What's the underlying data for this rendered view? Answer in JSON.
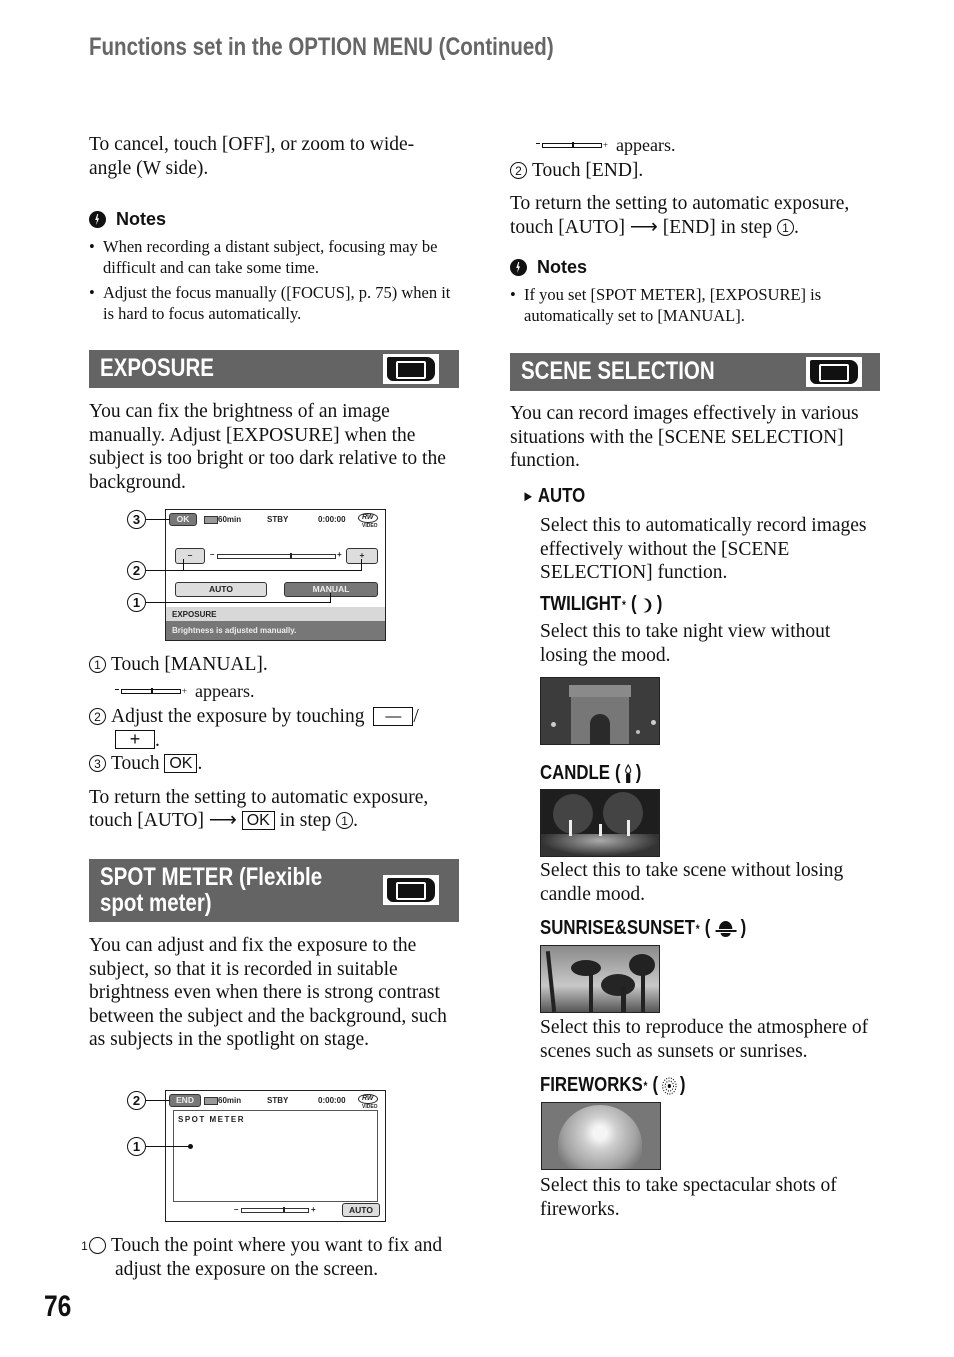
{
  "header": {
    "title": "Functions set in the OPTION MENU (Continued)"
  },
  "page_number": "76",
  "left_column": {
    "intro": "To cancel, touch [OFF], or zoom to wide-angle (W side).",
    "notes": {
      "title": "Notes",
      "icon": "notes-warning-icon",
      "items": [
        "When recording a distant subject, focusing may be difficult and can take some time.",
        "Adjust the focus manually ([FOCUS], p. 75) when it is hard to focus automatically."
      ]
    },
    "exposure": {
      "title": "EXPOSURE",
      "icon": "camcorder-icon",
      "description": "You can fix the brightness of an image manually. Adjust [EXPOSURE] when the subject is too bright or too dark relative to the background.",
      "screen": {
        "ok_button": "OK",
        "battery": "60min",
        "status": "STBY",
        "timecode": "0:00:00",
        "disc": "RW",
        "disc_sub": "VIDEO",
        "minus_button": "–",
        "plus_button": "+",
        "slider_minus": "–",
        "slider_plus": "+",
        "auto_button": "AUTO",
        "manual_button": "MANUAL",
        "panel_title": "EXPOSURE",
        "panel_message": "Brightness is adjusted manually.",
        "callouts": [
          "3",
          "2",
          "1"
        ]
      },
      "steps": {
        "s1_num": "1",
        "s1": "Touch [MANUAL].",
        "s1_appears": "appears.",
        "s2_num": "2",
        "s2": "Adjust the exposure by touching",
        "s2_minus": "—",
        "s2_slash": "/",
        "s2_plus": "+",
        "s2_end": ".",
        "s3_num": "3",
        "s3": "Touch",
        "s3_ok": "OK",
        "s3_end": "."
      },
      "return_text_a": "To return the setting to automatic exposure, touch [AUTO]",
      "return_arrow": "⟶",
      "return_ok": "OK",
      "return_text_b": "in step",
      "return_step": "1",
      "return_end": "."
    },
    "spot_meter": {
      "title_line1": "SPOT METER (Flexible",
      "title_line2": "spot meter)",
      "icon": "camcorder-icon",
      "description": "You can adjust and fix the exposure to the subject, so that it is recorded in suitable brightness even when there is strong contrast between the subject and the background, such as subjects in the spotlight on stage.",
      "screen": {
        "end_button": "END",
        "battery": "60min",
        "status": "STBY",
        "timecode": "0:00:00",
        "disc": "RW",
        "disc_sub": "VIDEO",
        "panel_title": "SPOT METER",
        "slider_minus": "–",
        "slider_plus": "+",
        "auto_button": "AUTO",
        "callouts": [
          "2",
          "1"
        ]
      },
      "step1_num": "1",
      "step1": "Touch the point where you want to fix and adjust the exposure on the screen."
    }
  },
  "right_column": {
    "appears": "appears.",
    "step2_num": "2",
    "step2": "Touch [END].",
    "return_text": "To return the setting to automatic exposure, touch [AUTO] ⟶ [END] in step",
    "return_step": "1",
    "return_end": ".",
    "notes": {
      "title": "Notes",
      "items": [
        "If you set [SPOT METER], [EXPOSURE] is automatically set to [MANUAL]."
      ]
    },
    "scene_selection": {
      "title": "SCENE SELECTION",
      "icon": "camcorder-icon",
      "description": "You can record images effectively in various situations with the [SCENE SELECTION] function.",
      "default_marker": "►",
      "options": [
        {
          "name": "AUTO",
          "asterisk": "",
          "icon": "",
          "description": "Select this to automatically record images effectively without the [SCENE SELECTION] function."
        },
        {
          "name": "TWILIGHT",
          "asterisk": "*",
          "icon": "moon-icon",
          "description": "Select this to take night view without losing the mood.",
          "photo": "arc-de-triomphe-night-photo"
        },
        {
          "name": "CANDLE",
          "asterisk": "",
          "icon": "candle-icon",
          "description": "Select this to take scene without losing candle mood.",
          "photo": "birthday-candles-photo"
        },
        {
          "name": "SUNRISE&SUNSET",
          "asterisk": "*",
          "icon": "sunset-icon",
          "description": "Select this to reproduce the atmosphere of scenes such as sunsets or sunrises.",
          "photo": "palm-trees-sunset-photo"
        },
        {
          "name": "FIREWORKS",
          "asterisk": "*",
          "icon": "fireworks-icon",
          "description": "Select this to take spectacular shots of fireworks.",
          "photo": "fireworks-photo"
        }
      ]
    }
  }
}
